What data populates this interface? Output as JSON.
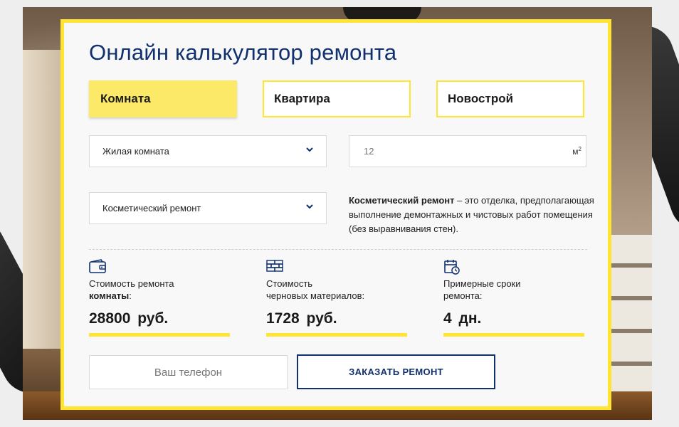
{
  "calculator": {
    "title": "Онлайн калькулятор ремонта",
    "types": [
      {
        "label": "Комната",
        "active": true
      },
      {
        "label": "Квартира",
        "active": false
      },
      {
        "label": "Новострой",
        "active": false
      }
    ],
    "room_select": {
      "value": "Жилая комната"
    },
    "area": {
      "placeholder": "12",
      "unit": "м",
      "unit_power": "2"
    },
    "repair_select": {
      "value": "Косметический ремонт"
    },
    "description": {
      "bold": "Косметический ремонт",
      "text": " – это отделка, предполагающая выполнение демонтажных и чистовых работ помещения (без выравнивания стен)."
    },
    "stats": [
      {
        "icon": "wallet-icon",
        "label_line1": "Стоимость ремонта",
        "label_bold": "комнаты",
        "label_suffix": ":",
        "value": "28800 руб."
      },
      {
        "icon": "bricks-icon",
        "label_line1": "Стоимость",
        "label_line2": "черновых материалов:",
        "value": "1728 руб."
      },
      {
        "icon": "calendar-icon",
        "label_line1": "Примерные сроки",
        "label_line2": "ремонта:",
        "value": "4 дн."
      }
    ],
    "phone": {
      "placeholder": "Ваш телефон"
    },
    "order_button": {
      "label": "ЗАКАЗАТЬ РЕМОНТ"
    }
  },
  "colors": {
    "accent_yellow": "#ffe431",
    "active_yellow": "#fde968",
    "navy": "#10306e"
  }
}
